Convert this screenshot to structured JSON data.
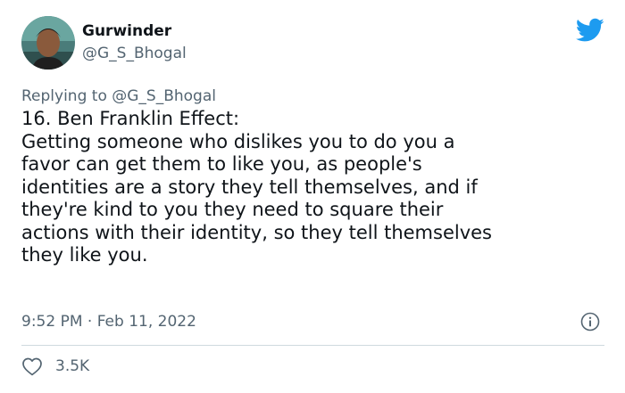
{
  "author": {
    "display_name": "Gurwinder",
    "handle": "@G_S_Bhogal",
    "avatar_icon": "user-avatar-photo"
  },
  "brand": {
    "logo_icon": "twitter-bird-icon",
    "accent_color": "#1d9bf0"
  },
  "reply": {
    "prefix": "Replying to ",
    "handle": "@G_S_Bhogal"
  },
  "tweet": {
    "lines": [
      "16. Ben Franklin Effect:",
      "Getting someone who dislikes you to do you a",
      "favor can get them to like you, as people's",
      "identities are a story they tell themselves, and if",
      "they're kind to you they need to square their",
      "actions with their identity, so they tell themselves",
      "they like you."
    ],
    "timestamp": "9:52 PM · Feb 11, 2022"
  },
  "actions": {
    "info_icon": "info-icon",
    "like_icon": "heart-icon",
    "like_count": "3.5K"
  },
  "colors": {
    "text_primary": "#0f1419",
    "text_secondary": "#536471",
    "divider": "#cfd9de"
  }
}
